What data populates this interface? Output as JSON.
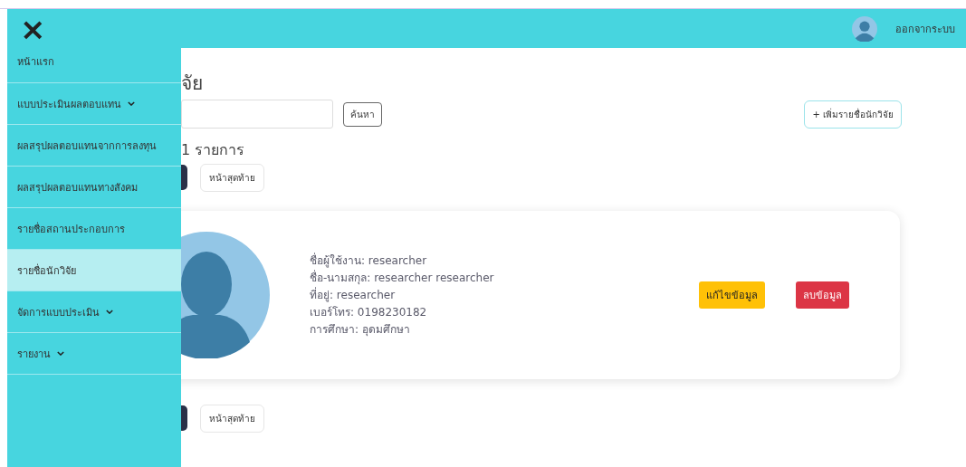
{
  "header": {
    "close_label": "×",
    "logout": "ออกจากระบบ"
  },
  "sidebar": {
    "items": [
      {
        "label": "หน้าแรก",
        "dropdown": false,
        "selected": false
      },
      {
        "label": "แบบประเมินผลตอบแทน",
        "dropdown": true,
        "selected": false
      },
      {
        "label": "ผลสรุปผลตอบแทนจากการลงทุน",
        "dropdown": false,
        "selected": false
      },
      {
        "label": "ผลสรุปผลตอบแทนทางสังคม",
        "dropdown": false,
        "selected": false
      },
      {
        "label": "รายชื่อสถานประกอบการ",
        "dropdown": false,
        "selected": false
      },
      {
        "label": "รายชื่อนักวิจัย",
        "dropdown": false,
        "selected": true
      },
      {
        "label": "จัดการแบบประเมิน",
        "dropdown": true,
        "selected": false
      },
      {
        "label": "รายงาน",
        "dropdown": true,
        "selected": false
      }
    ]
  },
  "page": {
    "title": "จัย",
    "search_button": "ค้นหา",
    "add_button": "+ เพิ่มรายชื่อนักวิจัย",
    "count": "1 รายการ",
    "last_page": "หน้าสุดท้าย",
    "last_page_bottom": "หน้าสุดท้าย"
  },
  "researchers": [
    {
      "lines": [
        "ชื่อผู้ใช้งาน: researcher",
        "ชื่อ-นามสกุล: researcher researcher",
        "ที่อยู่: researcher",
        "เบอร์โทร: 0198230182",
        "การศึกษา: อุดมศึกษา"
      ],
      "edit": "แก้ไขข้อมูล",
      "delete": "ลบข้อมูล"
    }
  ]
}
